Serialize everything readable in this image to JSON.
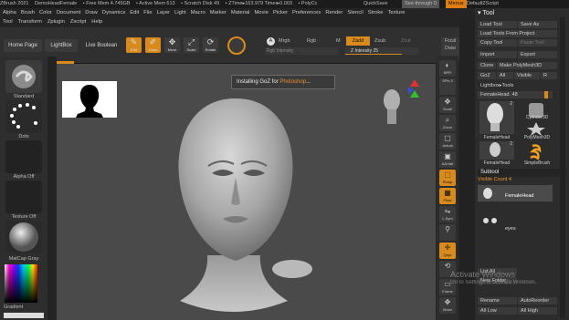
{
  "titlebar": {
    "app": "ZBrush 2021",
    "doc": "DemoHeadFemale",
    "free_mem": "• Free Mem 4.745GB",
    "active_mem": "• Active Mem 613",
    "scratch": "• Scratch Disk 49",
    "ztime": "• ZTime▸163.979 Timer▸0.003",
    "polycount": "• PolyCc",
    "quicksave": "QuickSave",
    "see_through": "See-through 0",
    "menus": "Menus",
    "default_script": "DefaultZScript"
  },
  "menubar": [
    "Alpha",
    "Brush",
    "Color",
    "Document",
    "Draw",
    "Dynamics",
    "Edit",
    "File",
    "Layer",
    "Light",
    "Macro",
    "Marker",
    "Material",
    "Movie",
    "Picker",
    "Preferences",
    "Render",
    "Stencil",
    "Stroke",
    "Texture"
  ],
  "submenubar": [
    "Tool",
    "Transform",
    "Zplugin",
    "Zscript",
    "Help"
  ],
  "topbar": {
    "home_page": "Home Page",
    "lightbox": "LightBox",
    "live_boolean": "Live Boolean",
    "tools": [
      {
        "label": "Edit",
        "glyph": "✎",
        "on": true
      },
      {
        "label": "Draw",
        "glyph": "✐",
        "on": true
      },
      {
        "label": "Move",
        "glyph": "✥",
        "on": false
      },
      {
        "label": "Scale",
        "glyph": "⤢",
        "on": false
      },
      {
        "label": "Rotate",
        "glyph": "⟳",
        "on": false
      }
    ],
    "a_label": "A",
    "mrgb": "Mrgb",
    "rgb": "Rgb",
    "m": "M",
    "zadd": "Zadd",
    "zsub": "Zsub",
    "zcut": "Zcut",
    "rgb_intensity": "Rgb Intensity",
    "z_intensity": "Z Intensity 25",
    "focal": "Focal",
    "draw_size": "Draw"
  },
  "left": {
    "standard": "Standard",
    "dots": "Dots",
    "alpha_off": "Alpha Off",
    "texture_off": "Texture Off",
    "matcap": "MatCap Gray",
    "gradient": "Gradient"
  },
  "popup": {
    "prefix": "Installing GoZ for ",
    "app": "Photoshop",
    "suffix": "..."
  },
  "rtools": [
    {
      "label": "BPR",
      "glyph": "◐",
      "on": false
    },
    {
      "label": "SPix 3",
      "glyph": "",
      "on": false
    },
    {
      "label": "Scroll",
      "glyph": "✥",
      "on": false
    },
    {
      "label": "Zoom",
      "glyph": "⌕",
      "on": false
    },
    {
      "label": "Actual",
      "glyph": "▢",
      "on": false
    },
    {
      "label": "AAHalf",
      "glyph": "▣",
      "on": false
    },
    {
      "label": "Persp",
      "glyph": "⬚",
      "on": true
    },
    {
      "label": "Floor",
      "glyph": "▦",
      "on": true
    },
    {
      "label": "L.Sym",
      "glyph": "⇋",
      "on": false
    },
    {
      "label": "",
      "glyph": "⚲",
      "on": false
    },
    {
      "label": "Qxyz",
      "glyph": "✛",
      "on": true
    },
    {
      "label": "",
      "glyph": "⟲",
      "on": false
    },
    {
      "label": "Frame",
      "glyph": "▭",
      "on": false
    },
    {
      "label": "Move",
      "glyph": "✥",
      "on": false
    }
  ],
  "rpanel": {
    "tool_header": "Tool",
    "load_tool": "Load Tool",
    "save_as": "Save As",
    "load_from_project": "Load Tools From Project",
    "copy_tool": "Copy Tool",
    "paste_tool": "Paste Tool",
    "import": "Import",
    "export": "Export",
    "clone": "Clone",
    "make_polymesh": "Make PolyMesh3D",
    "goz": "GoZ",
    "all": "All",
    "visible": "Visible",
    "r": "R",
    "lightbox_tools": "Lightbox▸Tools",
    "female_head_slider": "FemaleHead. 48",
    "thumbs": [
      {
        "label": "FemaleHead",
        "count": "2"
      },
      {
        "label": "Cylinder3D",
        "count": ""
      },
      {
        "label": "PolyMesh3D",
        "count": ""
      },
      {
        "label": "FemaleHead",
        "count": "2"
      },
      {
        "label": "SimpleBrush",
        "count": ""
      }
    ],
    "subtool_header": "Subtool",
    "visible_count": "Visible Count 4",
    "subtools": [
      "FemaleHead",
      "eyes"
    ],
    "list_all": "List All",
    "new_folder": "New Folder",
    "rename": "Rename",
    "auto_reorder": "AutoReorder",
    "all_low": "All Low",
    "all_high": "All High"
  },
  "watermark": {
    "line1": "Activate Windows",
    "line2": "Go to Settings to activate Windows."
  },
  "colors": {
    "accent": "#d98a1c",
    "panel": "#2c2c2c",
    "canvas": "#4a4a4a"
  }
}
